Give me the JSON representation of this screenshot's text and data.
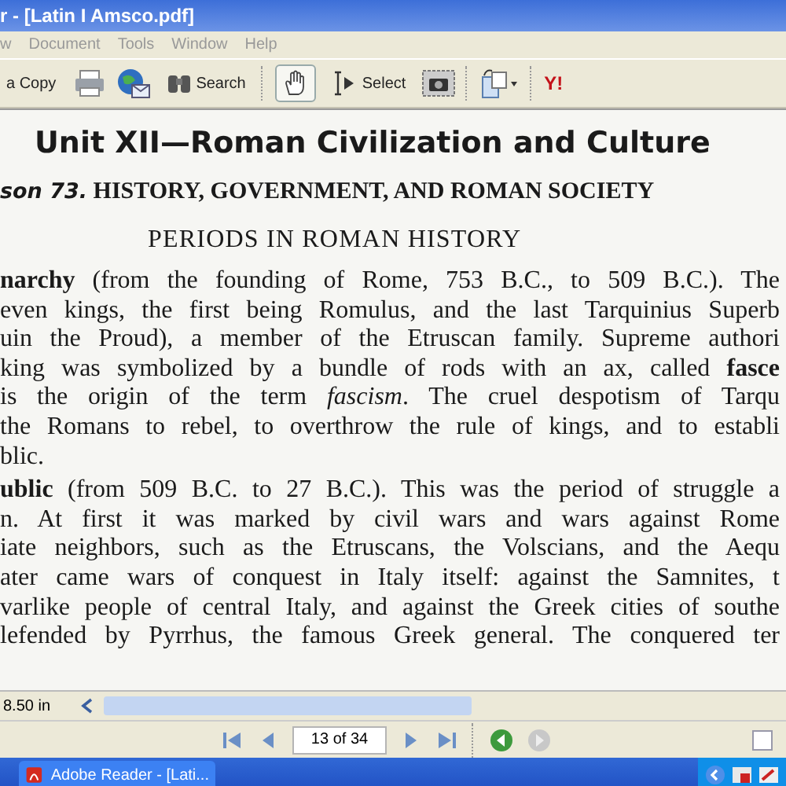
{
  "window": {
    "title": "r - [Latin I Amsco.pdf]"
  },
  "menu": [
    "w",
    "Document",
    "Tools",
    "Window",
    "Help"
  ],
  "toolbar": {
    "copy_label": "a Copy",
    "search_label": "Search",
    "hand_tool_selected": true,
    "select_label": "Select",
    "select_tool_selected": false,
    "logo": "Y!"
  },
  "document": {
    "heading": "Unit XII—Roman Civilization and Culture",
    "lesson_label": "son 73.",
    "lesson_title": "HISTORY, GOVERNMENT, AND ROMAN SOCIETY",
    "section_title": "PERIODS IN ROMAN HISTORY",
    "paragraphs": [
      [
        "**narchy** (from the founding of Rome, 753 B.C., to 509 B.C.). The",
        "even kings, the first being Romulus, and the last Tarquinius Superb",
        "uin the Proud), a member of the Etruscan family. Supreme authori",
        "king was symbolized by a bundle of rods with an ax, called **fasce**",
        "is the origin of the term *fascism*. The cruel despotism of Tarqu",
        "the Romans to rebel, to overthrow the rule of kings, and to establi",
        "blic."
      ],
      [
        "**ublic** (from 509 B.C. to 27 B.C.). This was the period of struggle a",
        "n. At first it was marked by civil wars and wars against Rome",
        "iate neighbors, such as the Etruscans, the Volscians, and the Aequ",
        "ater came wars of conquest in Italy itself: against the Samnites, t",
        "varlike people of central Italy, and against the Greek cities of southe",
        "lefended by Pyrrhus, the famous Greek general. The conquered ter"
      ]
    ]
  },
  "status_bar": {
    "page_size": "8.50 in"
  },
  "navigation": {
    "page_field": "13 of 34"
  },
  "taskbar": {
    "task": "Adobe Reader - [Lati..."
  }
}
